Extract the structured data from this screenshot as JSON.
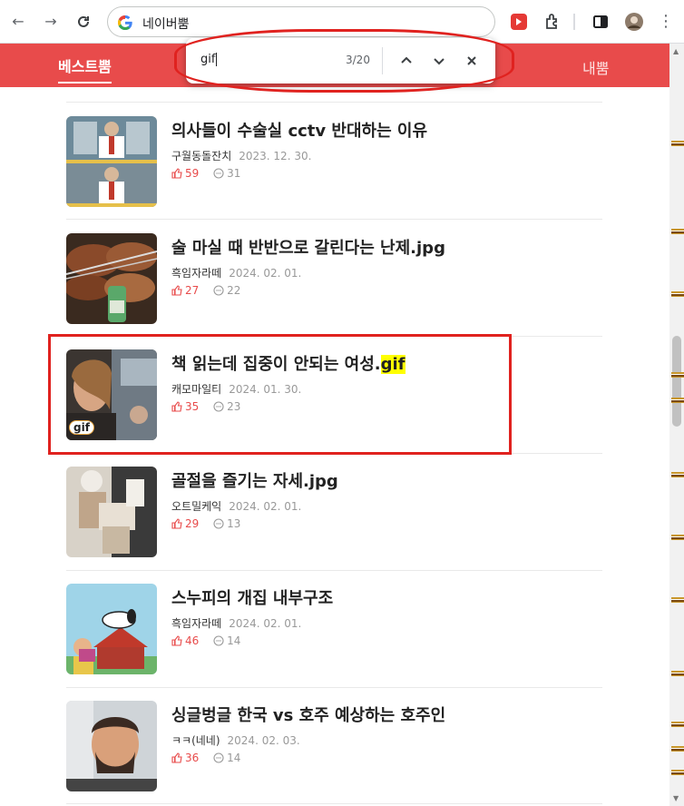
{
  "browser": {
    "address": "네이버뿜",
    "find": {
      "query": "gif",
      "count": "3/20"
    }
  },
  "site": {
    "tab_best": "베스트뿜",
    "tab_mine": "내뿜"
  },
  "colors": {
    "brand_red": "#e84b4b",
    "annotation_red": "#e0221f",
    "highlight": "#ffff00"
  },
  "posts": [
    {
      "title": "의사들이 수술실 cctv 반대하는 이유",
      "title_highlight": "",
      "author": "구월동돌잔치",
      "date": "2023. 12. 30.",
      "likes": "59",
      "comments": "31",
      "gif_badge": ""
    },
    {
      "title": "술 마실 때 반반으로 갈린다는 난제.jpg",
      "title_highlight": "",
      "author": "흑임자라떼",
      "date": "2024. 02. 01.",
      "likes": "27",
      "comments": "22",
      "gif_badge": ""
    },
    {
      "title": "책 읽는데 집중이 안되는 여성.",
      "title_highlight": "gif",
      "author": "캐모마일티",
      "date": "2024. 01. 30.",
      "likes": "35",
      "comments": "23",
      "gif_badge": "gif"
    },
    {
      "title": "골절을 즐기는 자세.jpg",
      "title_highlight": "",
      "author": "오트밀케익",
      "date": "2024. 02. 01.",
      "likes": "29",
      "comments": "13",
      "gif_badge": ""
    },
    {
      "title": "스누피의 개집 내부구조",
      "title_highlight": "",
      "author": "흑임자라떼",
      "date": "2024. 02. 01.",
      "likes": "46",
      "comments": "14",
      "gif_badge": ""
    },
    {
      "title": "싱글벙글 한국 vs 호주 예상하는 호주인",
      "title_highlight": "",
      "author": "ㅋㅋ(네네)",
      "date": "2024. 02. 03.",
      "likes": "36",
      "comments": "14",
      "gif_badge": ""
    }
  ]
}
